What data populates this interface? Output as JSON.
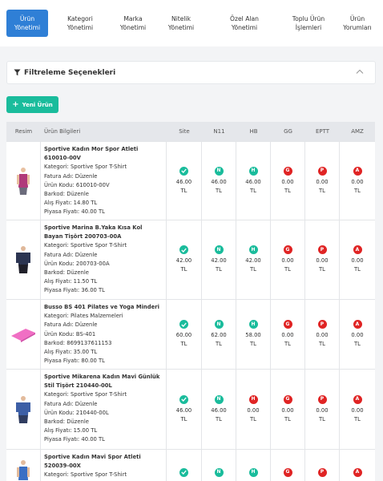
{
  "nav": {
    "tabs": [
      {
        "label": "Ürün\nYönetimi",
        "active": true
      },
      {
        "label": "Kategori\nYönetimi",
        "active": false
      },
      {
        "label": "Marka\nYönetimi",
        "active": false
      },
      {
        "label": "Nitelik\nYönetimi",
        "active": false
      },
      {
        "label": "Özel Alan\nYönetimi",
        "active": false
      },
      {
        "label": "Toplu Ürün\nİşlemleri",
        "active": false
      },
      {
        "label": "Ürün\nYorumları",
        "active": false
      }
    ]
  },
  "filter": {
    "title": "Filtreleme Seçenekleri"
  },
  "toolbar": {
    "new_label": "Yeni Ürün"
  },
  "table": {
    "headers": [
      "Resim",
      "Ürün Bilgileri",
      "Site",
      "N11",
      "HB",
      "GG",
      "EPTT",
      "AMZ"
    ],
    "marketplace_letters": [
      "N",
      "H",
      "G",
      "P",
      "A"
    ],
    "rows": [
      {
        "name": "Sportive Kadın Mor Spor Atleti 610010-00V",
        "category": "Kategori: Sportive Spor T-Shirt",
        "invoice": "Fatura Adı: Düzenle",
        "code": "Ürün Kodu: 610010-00V",
        "barcode": "Barkod: Düzenle",
        "buy": "Alış Fiyatı: 14.80 TL",
        "market": "Piyasa Fiyatı: 40.00 TL",
        "site": "46.00",
        "n11": "46.00",
        "n11_active": true,
        "hb": "46.00",
        "hb_active": true,
        "gg": "0.00",
        "eptt": "0.00",
        "amz": "0.00",
        "image": "purple-tank-top"
      },
      {
        "name": "Sportive Marina B.Yaka Kısa Kol Bayan Tişört 200703-00A",
        "category": "Kategori: Sportive Spor T-Shirt",
        "invoice": "Fatura Adı: Düzenle",
        "code": "Ürün Kodu: 200703-00A",
        "barcode": "Barkod: Düzenle",
        "buy": "Alış Fiyatı: 11.50 TL",
        "market": "Piyasa Fiyatı: 36.00 TL",
        "site": "42.00",
        "n11": "42.00",
        "n11_active": true,
        "hb": "42.00",
        "hb_active": true,
        "gg": "0.00",
        "eptt": "0.00",
        "amz": "0.00",
        "image": "navy-tshirt"
      },
      {
        "name": "Busso BS 401 Pilates ve Yoga Minderi",
        "category": "Kategori: Pilates Malzemeleri",
        "invoice": "Fatura Adı: Düzenle",
        "code": "Ürün Kodu: BS-401",
        "barcode": "Barkod: 8699137611153",
        "buy": "Alış Fiyatı: 35.00 TL",
        "market": "Piyasa Fiyatı: 80.00 TL",
        "site": "60.00",
        "n11": "62.00",
        "n11_active": true,
        "hb": "58.00",
        "hb_active": true,
        "gg": "0.00",
        "eptt": "0.00",
        "amz": "0.00",
        "image": "pink-yoga-mat"
      },
      {
        "name": "Sportive Mikarena Kadın Mavi Günlük Stil Tişört 210440-00L",
        "category": "Kategori: Sportive Spor T-Shirt",
        "invoice": "Fatura Adı: Düzenle",
        "code": "Ürün Kodu: 210440-00L",
        "barcode": "Barkod: Düzenle",
        "buy": "Alış Fiyatı: 15.00 TL",
        "market": "Piyasa Fiyatı: 40.00 TL",
        "site": "46.00",
        "n11": "46.00",
        "n11_active": true,
        "hb": "0.00",
        "hb_active": false,
        "gg": "0.00",
        "eptt": "0.00",
        "amz": "0.00",
        "image": "blue-tshirt"
      },
      {
        "name": "Sportive Kadın Mavi Spor Atleti 520039-00X",
        "category": "Kategori: Sportive Spor T-Shirt",
        "invoice": "",
        "code": "",
        "barcode": "",
        "buy": "",
        "market": "",
        "site": "",
        "n11": "",
        "n11_active": true,
        "hb": "",
        "hb_active": true,
        "gg": "",
        "eptt": "",
        "amz": "",
        "image": "blue-tank-top"
      }
    ]
  },
  "colors": {
    "accent": "#2f7fd6",
    "success": "#1abc9c",
    "danger": "#e02424"
  }
}
